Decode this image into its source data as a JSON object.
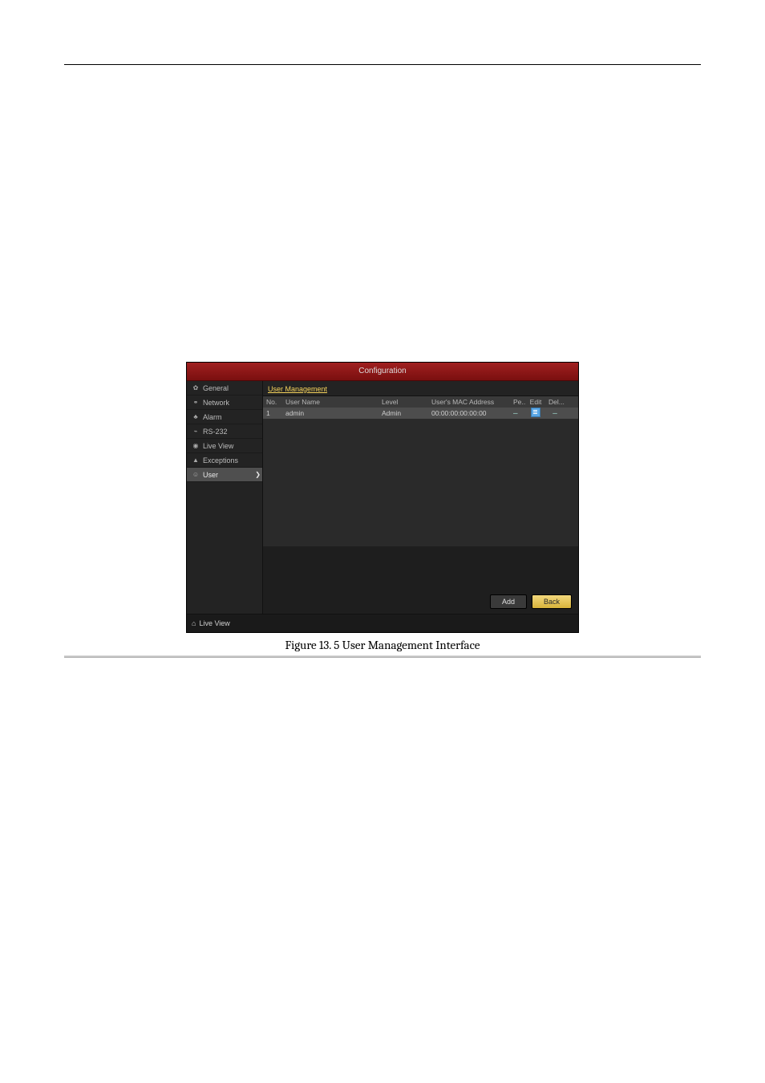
{
  "window": {
    "title": "Configuration"
  },
  "sidebar": {
    "items": [
      {
        "label": "General",
        "icon": "gear"
      },
      {
        "label": "Network",
        "icon": "network"
      },
      {
        "label": "Alarm",
        "icon": "alarm"
      },
      {
        "label": "RS-232",
        "icon": "serial"
      },
      {
        "label": "Live View",
        "icon": "eye"
      },
      {
        "label": "Exceptions",
        "icon": "warning"
      },
      {
        "label": "User",
        "icon": "user",
        "active": true
      }
    ]
  },
  "tab": {
    "label": "User Management"
  },
  "table": {
    "headers": {
      "no": "No.",
      "user_name": "User Name",
      "level": "Level",
      "mac": "User's MAC Address",
      "pe": "Pe...",
      "edit": "Edit",
      "del": "Del..."
    },
    "rows": [
      {
        "no": "1",
        "user_name": "admin",
        "level": "Admin",
        "mac": "00:00:00:00:00:00",
        "pe": "–",
        "del": "–"
      }
    ]
  },
  "footer": {
    "add_label": "Add",
    "back_label": "Back",
    "live_view_label": "Live View"
  },
  "caption": "Figure 13. 5 User Management Interface"
}
